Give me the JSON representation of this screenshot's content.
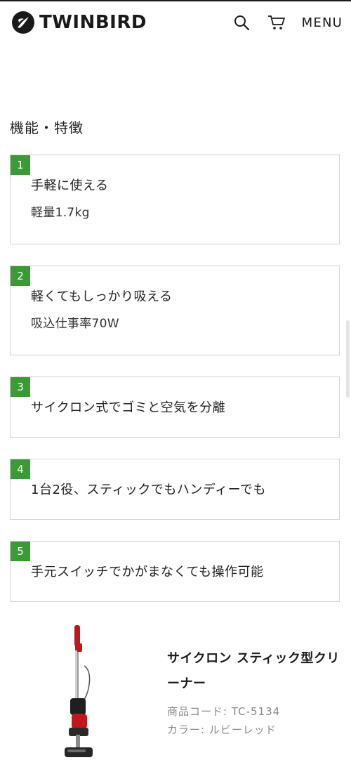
{
  "header": {
    "brand": "TWINBIRD",
    "menu_label": "MENU",
    "icons": {
      "logo": "twinbird-logo-icon",
      "search": "search-icon",
      "cart": "cart-icon"
    }
  },
  "section": {
    "title": "機能・特徴"
  },
  "features": [
    {
      "number": "1",
      "heading": "手軽に使える",
      "detail": "軽量1.7kg"
    },
    {
      "number": "2",
      "heading": "軽くてもしっかり吸える",
      "detail": "吸込仕事率70W"
    },
    {
      "number": "3",
      "heading": "サイクロン式でゴミと空気を分離"
    },
    {
      "number": "4",
      "heading": "1台2役、スティックでもハンディーでも"
    },
    {
      "number": "5",
      "heading": "手元スイッチでかがまなくても操作可能"
    }
  ],
  "product": {
    "name": "サイクロン スティック型クリーナー",
    "code": "商品コード: TC-5134",
    "color": "カラー: ルビーレッド"
  },
  "colors": {
    "accent_green": "#3a9a33",
    "product_red": "#c01818"
  }
}
